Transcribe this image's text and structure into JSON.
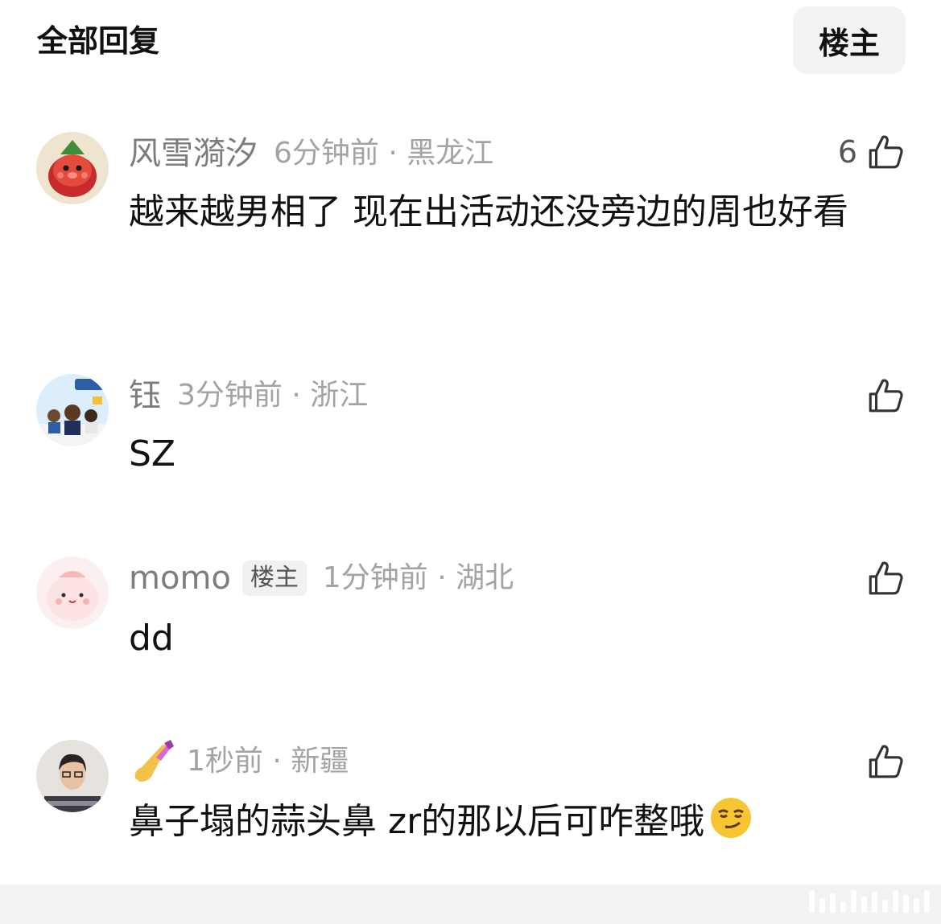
{
  "header": {
    "title": "全部回复",
    "filter_label": "楼主"
  },
  "comments": [
    {
      "username": "风雪漪汐",
      "time": "6分钟前 · 黑龙江",
      "content": "越来越男相了 现在出活动还没旁边的周也好看",
      "likes": "6",
      "avatar_icon": "strawberry-character-avatar"
    },
    {
      "username": "钰",
      "time": "3分钟前 · 浙江",
      "content": "SZ",
      "likes": "",
      "avatar_icon": "cartoon-people-avatar"
    },
    {
      "username": "momo",
      "badge": "楼主",
      "time": "1分钟前 · 湖北",
      "content": "dd",
      "likes": "",
      "avatar_icon": "pink-blob-avatar"
    },
    {
      "username_emoji": "nail-polish-emoji",
      "time": "1秒前 · 新疆",
      "content": "鼻子塌的蒜头鼻 zr的那以后可咋整哦",
      "content_emoji": "smirking-face-emoji",
      "likes": "",
      "avatar_icon": "person-photo-avatar"
    }
  ],
  "colors": {
    "username": "#7d7d7d",
    "time": "#a3a3a3",
    "text": "#111111",
    "badge_bg": "#f1f1f1"
  }
}
